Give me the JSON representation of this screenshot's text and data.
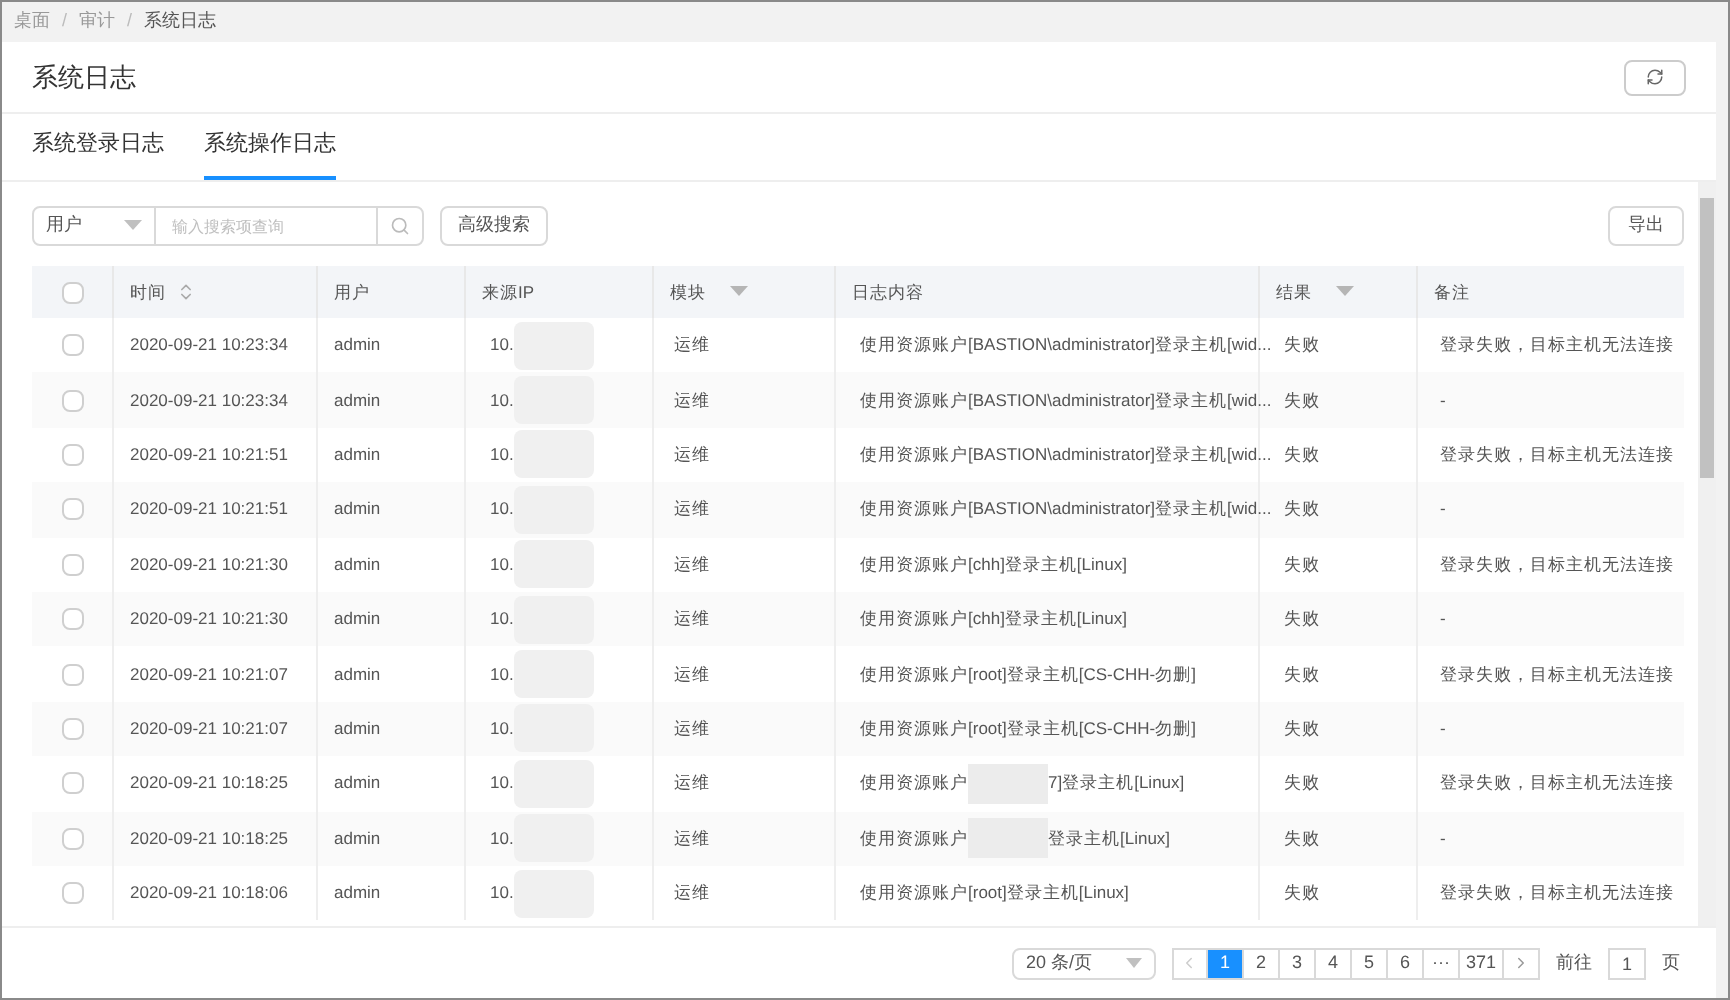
{
  "breadcrumb": [
    "桌面",
    "审计",
    "系统日志"
  ],
  "breadcrumb_separator": "/",
  "page_title": "系统日志",
  "tabs": [
    {
      "label": "系统登录日志",
      "selected": false
    },
    {
      "label": "系统操作日志",
      "selected": true
    }
  ],
  "search": {
    "field": "用户",
    "placeholder": "输入搜索项查询",
    "advanced_button": "高级搜索"
  },
  "export_button": "导出",
  "table": {
    "header_checked": false,
    "columns": [
      {
        "label": "时间",
        "kind": "sort"
      },
      {
        "label": "用户",
        "kind": "plain"
      },
      {
        "label": "来源IP",
        "kind": "plain"
      },
      {
        "label": "模块",
        "kind": "filter"
      },
      {
        "label": "日志内容",
        "kind": "plain"
      },
      {
        "label": "结果",
        "kind": "filter"
      },
      {
        "label": "备注",
        "kind": "plain"
      }
    ],
    "rows": [
      {
        "checked": false,
        "time": "2020-09-21 10:23:34",
        "user": "admin",
        "ip": "10.",
        "ip_redacted": true,
        "module": "运维",
        "log": [
          "使用资源账户[BASTION\\administrator]登录主机[wid..."
        ],
        "result": "失败",
        "note": "登录失败，目标主机无法连接"
      },
      {
        "checked": false,
        "time": "2020-09-21 10:23:34",
        "user": "admin",
        "ip": "10.",
        "ip_redacted": true,
        "module": "运维",
        "log": [
          "使用资源账户[BASTION\\administrator]登录主机[wid..."
        ],
        "result": "失败",
        "note": "-"
      },
      {
        "checked": false,
        "time": "2020-09-21 10:21:51",
        "user": "admin",
        "ip": "10.",
        "ip_redacted": true,
        "module": "运维",
        "log": [
          "使用资源账户[BASTION\\administrator]登录主机[wid..."
        ],
        "result": "失败",
        "note": "登录失败，目标主机无法连接"
      },
      {
        "checked": false,
        "time": "2020-09-21 10:21:51",
        "user": "admin",
        "ip": "10.",
        "ip_redacted": true,
        "module": "运维",
        "log": [
          "使用资源账户[BASTION\\administrator]登录主机[wid..."
        ],
        "result": "失败",
        "note": "-"
      },
      {
        "checked": false,
        "time": "2020-09-21 10:21:30",
        "user": "admin",
        "ip": "10.",
        "ip_redacted": true,
        "module": "运维",
        "log": [
          "使用资源账户[chh]登录主机[Linux]"
        ],
        "result": "失败",
        "note": "登录失败，目标主机无法连接"
      },
      {
        "checked": false,
        "time": "2020-09-21 10:21:30",
        "user": "admin",
        "ip": "10.",
        "ip_redacted": true,
        "module": "运维",
        "log": [
          "使用资源账户[chh]登录主机[Linux]"
        ],
        "result": "失败",
        "note": "-"
      },
      {
        "checked": false,
        "time": "2020-09-21 10:21:07",
        "user": "admin",
        "ip": "10.",
        "ip_redacted": true,
        "module": "运维",
        "log": [
          "使用资源账户[root]登录主机[CS-CHH-勿删]"
        ],
        "result": "失败",
        "note": "登录失败，目标主机无法连接"
      },
      {
        "checked": false,
        "time": "2020-09-21 10:21:07",
        "user": "admin",
        "ip": "10.",
        "ip_redacted": true,
        "module": "运维",
        "log": [
          "使用资源账户[root]登录主机[CS-CHH-勿删]"
        ],
        "result": "失败",
        "note": "-"
      },
      {
        "checked": false,
        "time": "2020-09-21 10:18:25",
        "user": "admin",
        "ip": "10.",
        "ip_redacted": true,
        "module": "运维",
        "log": [
          "使用资源账户",
          "7]登录主机[Linux]"
        ],
        "result": "失败",
        "note": "登录失败，目标主机无法连接"
      },
      {
        "checked": false,
        "time": "2020-09-21 10:18:25",
        "user": "admin",
        "ip": "10.",
        "ip_redacted": true,
        "module": "运维",
        "log": [
          "使用资源账户",
          "登录主机[Linux]"
        ],
        "result": "失败",
        "note": "-"
      },
      {
        "checked": false,
        "time": "2020-09-21 10:18:06",
        "user": "admin",
        "ip": "10.",
        "ip_redacted": true,
        "module": "运维",
        "log": [
          "使用资源账户[root]登录主机[Linux]"
        ],
        "result": "失败",
        "note": "登录失败，目标主机无法连接"
      }
    ]
  },
  "pagination": {
    "page_size": "20 条/页",
    "pages": [
      {
        "label": "1",
        "selected": true
      },
      {
        "label": "2",
        "selected": false
      },
      {
        "label": "3",
        "selected": false
      },
      {
        "label": "4",
        "selected": false
      },
      {
        "label": "5",
        "selected": false
      },
      {
        "label": "6",
        "selected": false
      },
      {
        "label": "···",
        "selected": false
      },
      {
        "label": "371",
        "selected": false
      }
    ],
    "goto_label": "前往",
    "goto_value": "1",
    "page_suffix": "页"
  }
}
